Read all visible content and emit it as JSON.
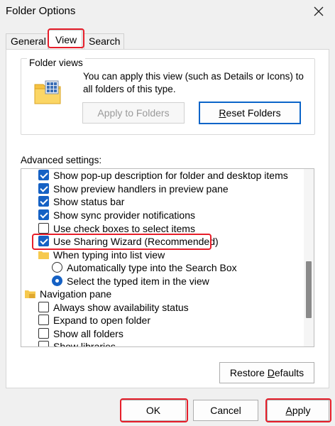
{
  "window": {
    "title": "Folder Options"
  },
  "tabs": [
    {
      "label": "General"
    },
    {
      "label": "View"
    },
    {
      "label": "Search"
    }
  ],
  "folder_views": {
    "title": "Folder views",
    "description": "You can apply this view (such as Details or Icons) to all folders of this type.",
    "apply_button": "Apply to Folders",
    "reset_button_u": "R",
    "reset_button_rest": "eset Folders"
  },
  "advanced": {
    "label": "Advanced settings:",
    "items": [
      {
        "type": "checkbox",
        "checked": true,
        "label": "Show pop-up description for folder and desktop items"
      },
      {
        "type": "checkbox",
        "checked": true,
        "label": "Show preview handlers in preview pane"
      },
      {
        "type": "checkbox",
        "checked": true,
        "label": "Show status bar"
      },
      {
        "type": "checkbox",
        "checked": true,
        "label": "Show sync provider notifications"
      },
      {
        "type": "checkbox",
        "checked": false,
        "label": "Use check boxes to select items"
      },
      {
        "type": "checkbox",
        "checked": true,
        "label": "Use Sharing Wizard (Recommended)"
      },
      {
        "type": "folder",
        "label": "When typing into list view"
      },
      {
        "type": "radio",
        "checked": false,
        "label": "Automatically type into the Search Box"
      },
      {
        "type": "radio",
        "checked": true,
        "label": "Select the typed item in the view"
      },
      {
        "type": "folder",
        "label": "Navigation pane"
      },
      {
        "type": "checkbox",
        "checked": false,
        "label": "Always show availability status"
      },
      {
        "type": "checkbox",
        "checked": false,
        "label": "Expand to open folder"
      },
      {
        "type": "checkbox",
        "checked": false,
        "label": "Show all folders"
      },
      {
        "type": "checkbox",
        "checked": false,
        "label": "Show libraries"
      }
    ],
    "restore_button_pre": "Restore ",
    "restore_button_u": "D",
    "restore_button_post": "efaults"
  },
  "footer": {
    "ok": "OK",
    "cancel": "Cancel",
    "apply_u": "A",
    "apply_rest": "pply"
  },
  "colors": {
    "highlight": "#e61e2a",
    "accent": "#1561c4"
  }
}
